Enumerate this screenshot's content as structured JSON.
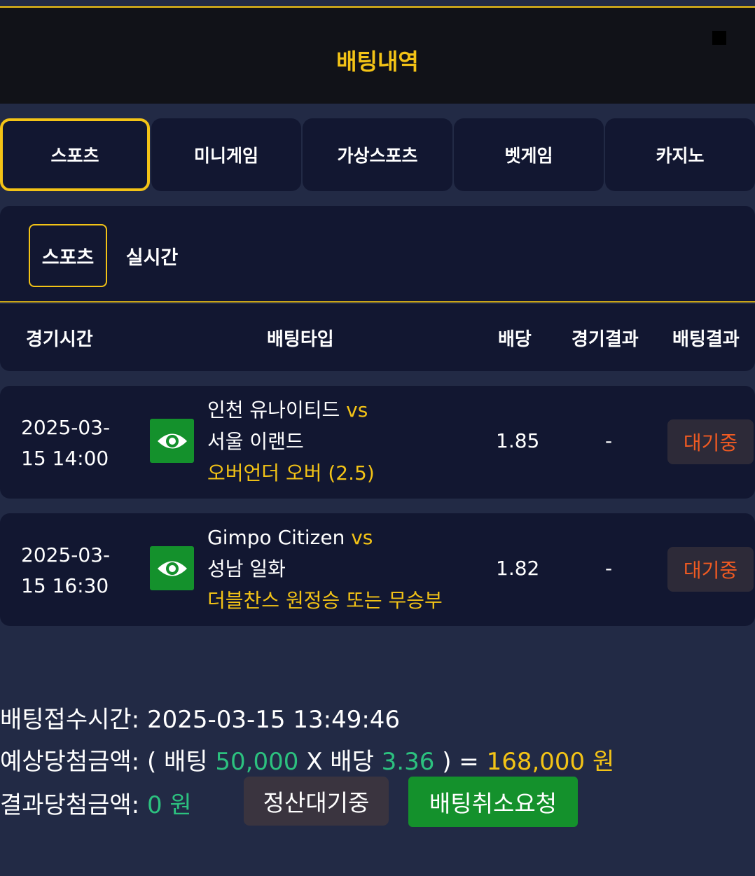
{
  "header": {
    "title": "배팅내역"
  },
  "tabs": [
    "스포츠",
    "미니게임",
    "가상스포츠",
    "벳게임",
    "카지노"
  ],
  "subtabs": [
    "스포츠",
    "실시간"
  ],
  "columns": {
    "time": "경기시간",
    "bet_type": "배팅타입",
    "odds": "배당",
    "game_result": "경기결과",
    "bet_result": "배팅결과"
  },
  "bets": [
    {
      "time_line1": "2025-03-",
      "time_line2": "15 14:00",
      "home": "인천 유나이티드",
      "vs": "vs",
      "away": "서울 이랜드",
      "bet_type": "오버언더 오버 (2.5)",
      "odds": "1.85",
      "result": "-",
      "status": "대기중"
    },
    {
      "time_line1": "2025-03-",
      "time_line2": "15 16:30",
      "home": "Gimpo Citizen",
      "vs": "vs",
      "away": "성남 일화",
      "bet_type": "더블찬스 원정승 또는 무승부",
      "odds": "1.82",
      "result": "-",
      "status": "대기중"
    }
  ],
  "summary": {
    "receipt_label": "배팅접수시간:",
    "receipt_time": "2025-03-15 13:49:46",
    "expected_label": "예상당첨금액:",
    "open_paren": "(",
    "bet_word": "배팅",
    "bet_amount": "50,000",
    "x": "X",
    "odds_word": "배당",
    "total_odds": "3.36",
    "close_eq": ") =",
    "expected_amount": "168,000 원",
    "result_label": "결과당첨금액:",
    "result_amount": "0 원"
  },
  "buttons": {
    "pending": "정산대기중",
    "cancel": "배팅취소요청"
  },
  "colors": {
    "accent": "#f3c316",
    "panel": "#121731",
    "background": "#222a45",
    "green_button": "#14912c",
    "status_text": "#f05a22"
  }
}
